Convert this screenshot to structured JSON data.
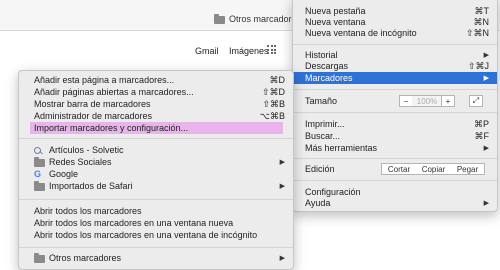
{
  "bookmarks_bar": {
    "other_bookmarks": "Otros marcadores"
  },
  "page": {
    "gmail": "Gmail",
    "imagenes": "Imágenes"
  },
  "menu": {
    "items": [
      {
        "label": "Nueva pestaña",
        "shortcut": "⌘T"
      },
      {
        "label": "Nueva ventana",
        "shortcut": "⌘N"
      },
      {
        "label": "Nueva ventana de incógnito",
        "shortcut": "⇧⌘N"
      },
      {
        "label": "Historial",
        "arrow": "▶"
      },
      {
        "label": "Descargas",
        "shortcut": "⇧⌘J"
      },
      {
        "label": "Marcadores",
        "arrow": "▶"
      },
      {
        "label": "Tamaño"
      },
      {
        "label": "Imprimir...",
        "shortcut": "⌘P"
      },
      {
        "label": "Buscar...",
        "shortcut": "⌘F"
      },
      {
        "label": "Más herramientas",
        "arrow": "▶"
      },
      {
        "label": "Edición"
      },
      {
        "label": "Configuración"
      },
      {
        "label": "Ayuda",
        "arrow": "▶"
      }
    ],
    "zoom": {
      "minus": "−",
      "value": "100%",
      "plus": "+",
      "fullscreen": "⤢"
    },
    "edit": {
      "cut": "Cortar",
      "copy": "Copiar",
      "paste": "Pegar"
    }
  },
  "bookmarks_menu": {
    "items": [
      {
        "label": "Añadir esta página a marcadores...",
        "shortcut": "⌘D"
      },
      {
        "label": "Añadir páginas abiertas a marcadores...",
        "shortcut": "⇧⌘D"
      },
      {
        "label": "Mostrar barra de marcadores",
        "shortcut": "⇧⌘B"
      },
      {
        "label": "Administrador de marcadores",
        "shortcut": "⌥⌘B"
      },
      {
        "label": "Importar marcadores y configuración..."
      },
      {
        "label": "Artículos - Solvetic"
      },
      {
        "label": "Redes Sociales",
        "arrow": "▶"
      },
      {
        "label": "Google"
      },
      {
        "label": "Importados de Safari",
        "arrow": "▶"
      },
      {
        "label": "Abrir todos los marcadores"
      },
      {
        "label": "Abrir todos los marcadores en una ventana nueva"
      },
      {
        "label": "Abrir todos los marcadores en una ventana de incógnito"
      },
      {
        "label": "Otros marcadores",
        "arrow": "▶"
      }
    ]
  },
  "colors": {
    "selection": "#2f72d6",
    "highlight": "#e9b4ec"
  }
}
